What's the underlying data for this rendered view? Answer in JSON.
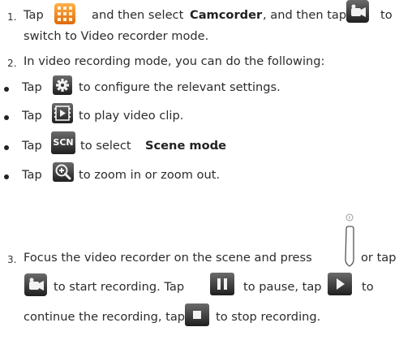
{
  "steps": [
    {
      "number": "1.",
      "line1": {
        "a": "Tap",
        "b": "and then select",
        "c": "Camcorder",
        "d": ", and then tap",
        "e": "to"
      },
      "line2": "switch to Video recorder mode."
    },
    {
      "number": "2.",
      "line1": "In video recording mode, you can do the following:"
    },
    {
      "number": "3.",
      "line1": {
        "a": "Focus the video recorder on the scene and press",
        "b": "or tap"
      },
      "line2": {
        "a": "to start recording. Tap",
        "b": "to pause, tap",
        "c": "to"
      },
      "line3": {
        "a": "continue the recording, tap",
        "b": "to stop recording."
      }
    }
  ],
  "bullets": [
    {
      "a": "Tap",
      "b": "to configure the relevant settings."
    },
    {
      "a": "Tap",
      "b": "to play video clip."
    },
    {
      "a": "Tap",
      "b": "to select",
      "c": "Scene mode",
      "d": "."
    },
    {
      "a": "Tap",
      "b": "to zoom in or zoom out."
    }
  ],
  "icons": {
    "scene_label": "SCN"
  },
  "colors": {
    "app_icon_orange": "#f08a1c",
    "button_dark": "#3a3a3a",
    "accent_green": "#4caf50",
    "accent_red": "#d64545"
  }
}
